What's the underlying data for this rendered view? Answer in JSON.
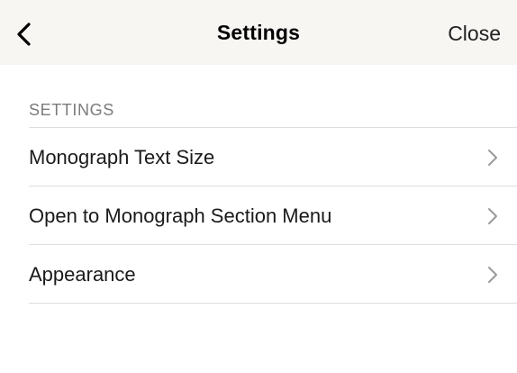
{
  "header": {
    "back_icon": "chevron-left-icon",
    "title": "Settings",
    "close_label": "Close"
  },
  "section": {
    "title": "SETTINGS",
    "items": [
      {
        "label": "Monograph Text Size",
        "icon": "chevron-right-icon"
      },
      {
        "label": "Open to Monograph Section Menu",
        "icon": "chevron-right-icon"
      },
      {
        "label": "Appearance",
        "icon": "chevron-right-icon"
      }
    ]
  },
  "colors": {
    "header_background": "#f7f6f3",
    "divider": "#dedede",
    "section_header_text": "#7b7b7b",
    "chevron": "#9a9a9a"
  }
}
